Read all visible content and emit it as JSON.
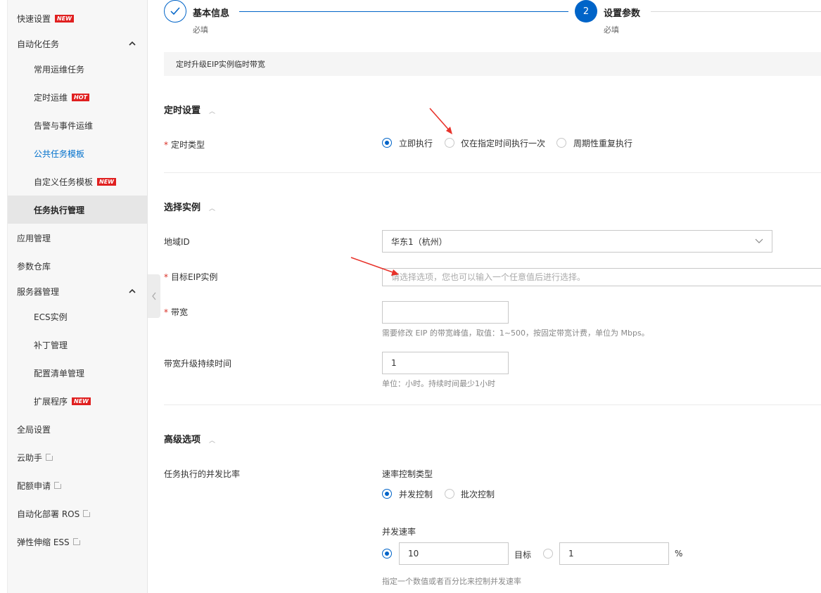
{
  "sidebar": {
    "items": [
      {
        "label": "快速设置",
        "badge": "NEW"
      },
      {
        "label": "自动化任务"
      },
      {
        "label": "常用运维任务"
      },
      {
        "label": "定时运维",
        "badge": "HOT"
      },
      {
        "label": "告警与事件运维"
      },
      {
        "label": "公共任务模板"
      },
      {
        "label": "自定义任务模板",
        "badge": "NEW"
      },
      {
        "label": "任务执行管理"
      },
      {
        "label": "应用管理"
      },
      {
        "label": "参数仓库"
      },
      {
        "label": "服务器管理"
      },
      {
        "label": "ECS实例"
      },
      {
        "label": "补丁管理"
      },
      {
        "label": "配置清单管理"
      },
      {
        "label": "扩展程序",
        "badge": "NEW"
      },
      {
        "label": "全局设置"
      },
      {
        "label": "云助手"
      },
      {
        "label": "配额申请"
      },
      {
        "label": "自动化部署 ROS"
      },
      {
        "label": "弹性伸缩 ESS"
      }
    ]
  },
  "steps": [
    {
      "title": "基本信息",
      "sub": "必填",
      "number": ""
    },
    {
      "title": "设置参数",
      "sub": "必填",
      "number": "2"
    }
  ],
  "banner": "定时升级EIP实例临时带宽",
  "sections": {
    "schedule": {
      "title": "定时设置"
    },
    "instance": {
      "title": "选择实例"
    },
    "advanced": {
      "title": "高级选项"
    }
  },
  "form": {
    "timer_type": {
      "label": "定时类型",
      "options": [
        "立即执行",
        "仅在指定时间执行一次",
        "周期性重复执行"
      ],
      "selected": "立即执行"
    },
    "region": {
      "label": "地域ID",
      "value": "华东1（杭州）"
    },
    "eip": {
      "label": "目标EIP实例",
      "placeholder": "请选择选项，您也可以输入一个任意值后进行选择。"
    },
    "bandwidth": {
      "label": "带宽",
      "value": "",
      "help": "需要修改 EIP 的带宽峰值，取值：1~500，按固定带宽计费，单位为 Mbps。"
    },
    "duration": {
      "label": "带宽升级持续时间",
      "value": "1",
      "help": "单位：小时。持续时间最少1小时"
    },
    "concurrency": {
      "label": "任务执行的并发比率",
      "rate_type_label": "速率控制类型",
      "rate_type_options": [
        "并发控制",
        "批次控制"
      ],
      "rate_type_selected": "并发控制",
      "rate_label": "并发速率",
      "rate_value": "10",
      "target_label": "目标",
      "target_value": "1",
      "unit": "%",
      "help": "指定一个数值或者百分比来控制并发速率"
    }
  },
  "colors": {
    "accent": "#0064c8",
    "badge": "#e02020",
    "annotation_arrow": "#e8322a"
  }
}
